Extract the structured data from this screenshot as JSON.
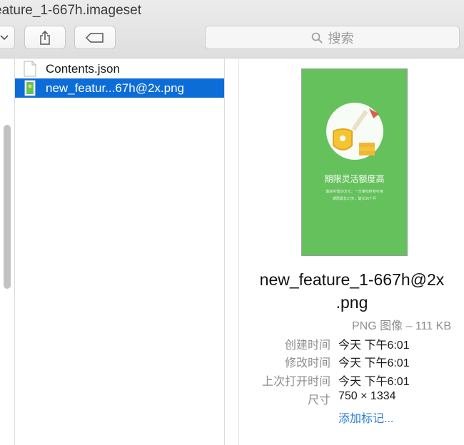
{
  "window": {
    "title": "eature_1-667h.imageset"
  },
  "toolbar": {
    "search_placeholder": "搜索",
    "icons": {
      "view": "chevron-down-icon",
      "share": "share-icon",
      "tag": "tag-icon",
      "search": "magnifier-icon"
    }
  },
  "files": [
    {
      "name": "Contents.json",
      "icon": "document-icon",
      "selected": false
    },
    {
      "name": "new_featur...67h@2x.png",
      "icon": "image-file-icon",
      "selected": true
    }
  ],
  "preview": {
    "image_headline": "期限灵活额度高",
    "image_subline_1": "最高可借50万元，一次审批终身可用",
    "image_subline_2": "期限最长37天，最长36个月",
    "filename_line1": "new_feature_1-667h@2x",
    "filename_line2": ".png",
    "kind": "PNG 图像 – 111 KB",
    "meta": [
      {
        "label": "创建时间",
        "value": "今天 下午6:01"
      },
      {
        "label": "修改时间",
        "value": "今天 下午6:01"
      },
      {
        "label": "上次打开时间",
        "value": "今天 下午6:01"
      },
      {
        "label": "尺寸",
        "value": "750 × 1334"
      }
    ],
    "add_tags": "添加标记..."
  },
  "colors": {
    "selection": "#0c6cd8",
    "thumbnail_green": "#65c15c",
    "link": "#2f7fd6"
  }
}
